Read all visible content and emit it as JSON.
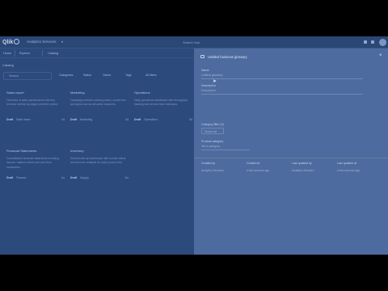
{
  "topbar": {
    "logo": "Qlik",
    "app_name": "Analytics Services",
    "search": "Search Hub"
  },
  "nav": {
    "items": [
      "Home",
      "Explore",
      "Catalog"
    ]
  },
  "page_label": "Catalog",
  "filters": {
    "search_placeholder": "Search",
    "chips": [
      "Categories",
      "Status",
      "Owner",
      "Tags",
      "All filters"
    ]
  },
  "cards": [
    {
      "title": "Sales report",
      "desc": "Overview of sales performance with key revenue metrics by region and time period.",
      "owner_label": "Draft",
      "owner": "Sales team",
      "date": "2d"
    },
    {
      "title": "Marketing",
      "desc": "Campaign metrics covering reach, conversion and spend across all active channels.",
      "owner_label": "Draft",
      "owner": "Marketing",
      "date": "3d"
    },
    {
      "title": "Operations",
      "desc": "Daily operations dashboard with throughput, backlog and service level indicators.",
      "owner_label": "Draft",
      "owner": "Operations",
      "date": "5d"
    },
    {
      "title": "Financial Statements",
      "desc": "Consolidated financial statements including income, balance sheet and cash flow summaries.",
      "owner_label": "Draft",
      "owner": "Finance",
      "date": "1w"
    },
    {
      "title": "Inventory",
      "desc": "Stock levels by warehouse with reorder alerts and turnover analysis for each product line.",
      "owner_label": "Draft",
      "owner": "Supply",
      "date": "2w"
    }
  ],
  "panel": {
    "title": "Untitled business glossary",
    "name_label": "Name",
    "name_value": "Untitled glossary",
    "description_label": "Description",
    "description_placeholder": "Description",
    "category_label": "Category filter (0)",
    "category_select": "Select cat",
    "product_label": "Product category",
    "product_placeholder": "Set a category",
    "meta": [
      {
        "key": "Created by",
        "value": "Analytics Services"
      },
      {
        "key": "Created at",
        "value": "a few seconds ago"
      },
      {
        "key": "Last updated by",
        "value": "Analytics Services"
      },
      {
        "key": "Last updated at",
        "value": "a few seconds ago"
      }
    ]
  },
  "colors": {
    "overlay": "#2c4a7c",
    "panel": "#4d6b9e"
  }
}
